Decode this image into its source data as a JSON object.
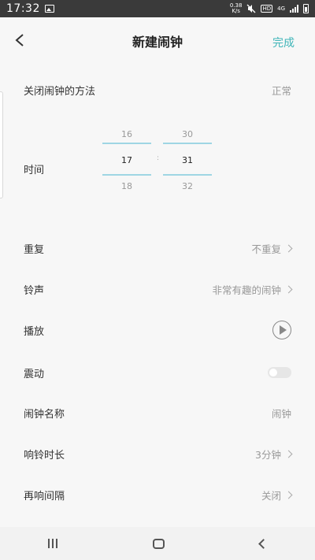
{
  "statusbar": {
    "time": "17:32",
    "speed_value": "0.38",
    "speed_unit": "K/s",
    "hd": "HD",
    "network": "4G"
  },
  "header": {
    "title": "新建闹钟",
    "done_label": "完成"
  },
  "close_method": {
    "label": "关闭闹钟的方法",
    "value": "正常"
  },
  "time": {
    "label": "时间",
    "hours": [
      "16",
      "17",
      "18"
    ],
    "minutes": [
      "30",
      "31",
      "32"
    ],
    "separator": ":"
  },
  "repeat": {
    "label": "重复",
    "value": "不重复"
  },
  "ringtone": {
    "label": "铃声",
    "value": "非常有趣的闹钟"
  },
  "play": {
    "label": "播放"
  },
  "vibrate": {
    "label": "震动",
    "enabled": false
  },
  "alarm_name": {
    "label": "闹钟名称",
    "value": "闹钟"
  },
  "ring_duration": {
    "label": "响铃时长",
    "value": "3分钟"
  },
  "snooze": {
    "label": "再响间隔",
    "value": "关闭"
  },
  "colors": {
    "accent": "#3fb5b8",
    "picker_line": "#9fd6e4"
  }
}
